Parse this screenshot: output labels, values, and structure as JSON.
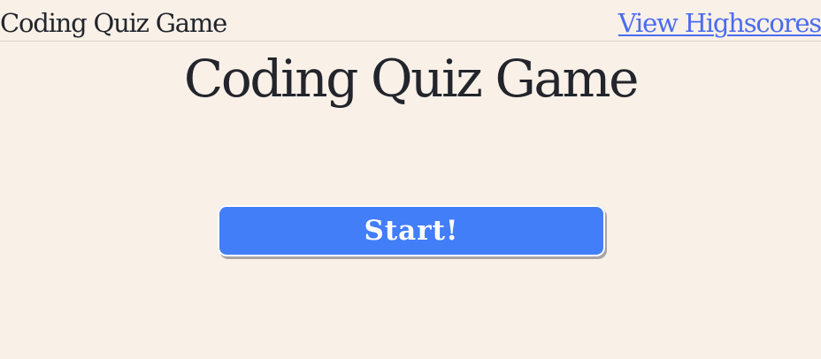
{
  "header": {
    "brand": "Coding Quiz Game",
    "highscores_link": "View Highscores"
  },
  "main": {
    "title": "Coding Quiz Game",
    "start_button": "Start!"
  },
  "colors": {
    "background": "#f9f0e8",
    "link": "#4a6cf0",
    "button": "#437ef9",
    "text": "#22252b"
  }
}
